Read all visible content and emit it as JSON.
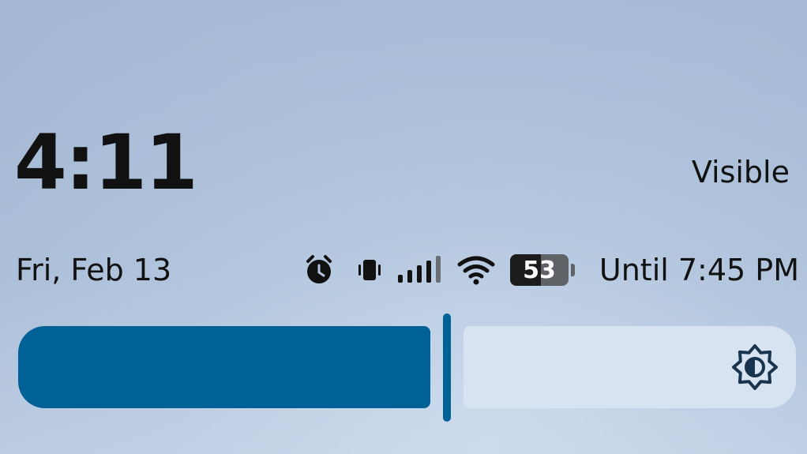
{
  "status_bar": {
    "time": "4:11",
    "carrier": "Visible",
    "date": "Fri, Feb 13",
    "battery_level": "53",
    "battery_fraction": 0.53,
    "until_text": "Until 7:45 PM",
    "icons": [
      "alarm-icon",
      "vibrate-icon",
      "cell-signal-icon",
      "wifi-icon",
      "battery-icon"
    ]
  },
  "brightness": {
    "level": 0.55,
    "icon": "brightness-icon"
  },
  "colors": {
    "accent": "#006196",
    "track": "#d8e3f1",
    "icon_accent": "#18344e"
  }
}
